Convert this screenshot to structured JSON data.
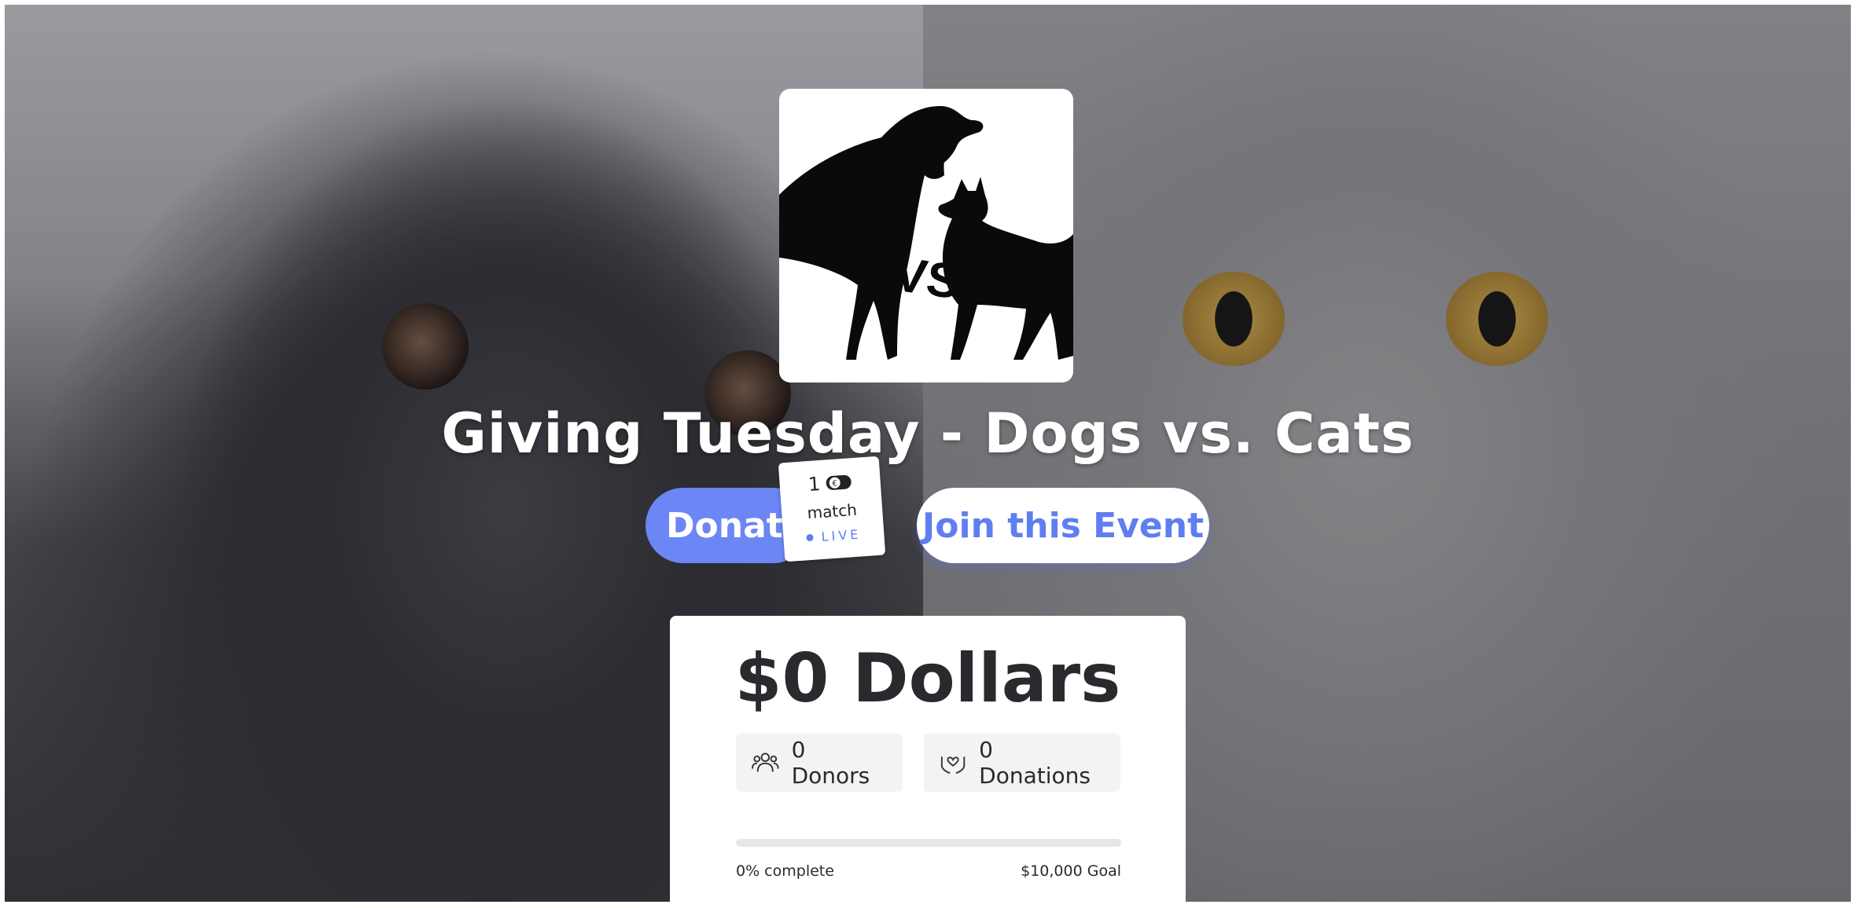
{
  "event": {
    "title": "Giving Tuesday - Dogs vs. Cats",
    "logo_text": "VS"
  },
  "actions": {
    "donate_label": "Donate",
    "join_label": "Join this Event"
  },
  "match_badge": {
    "count": "1",
    "label": "match",
    "status": "LIVE"
  },
  "stats": {
    "raised": "$0 Dollars",
    "donors": "0 Donors",
    "donations": "0 Donations",
    "progress_percent": 0,
    "progress_label": "0% complete",
    "goal_label": "$10,000 Goal"
  },
  "colors": {
    "accent": "#6b86f5",
    "accent_text": "#5f7ef0"
  }
}
